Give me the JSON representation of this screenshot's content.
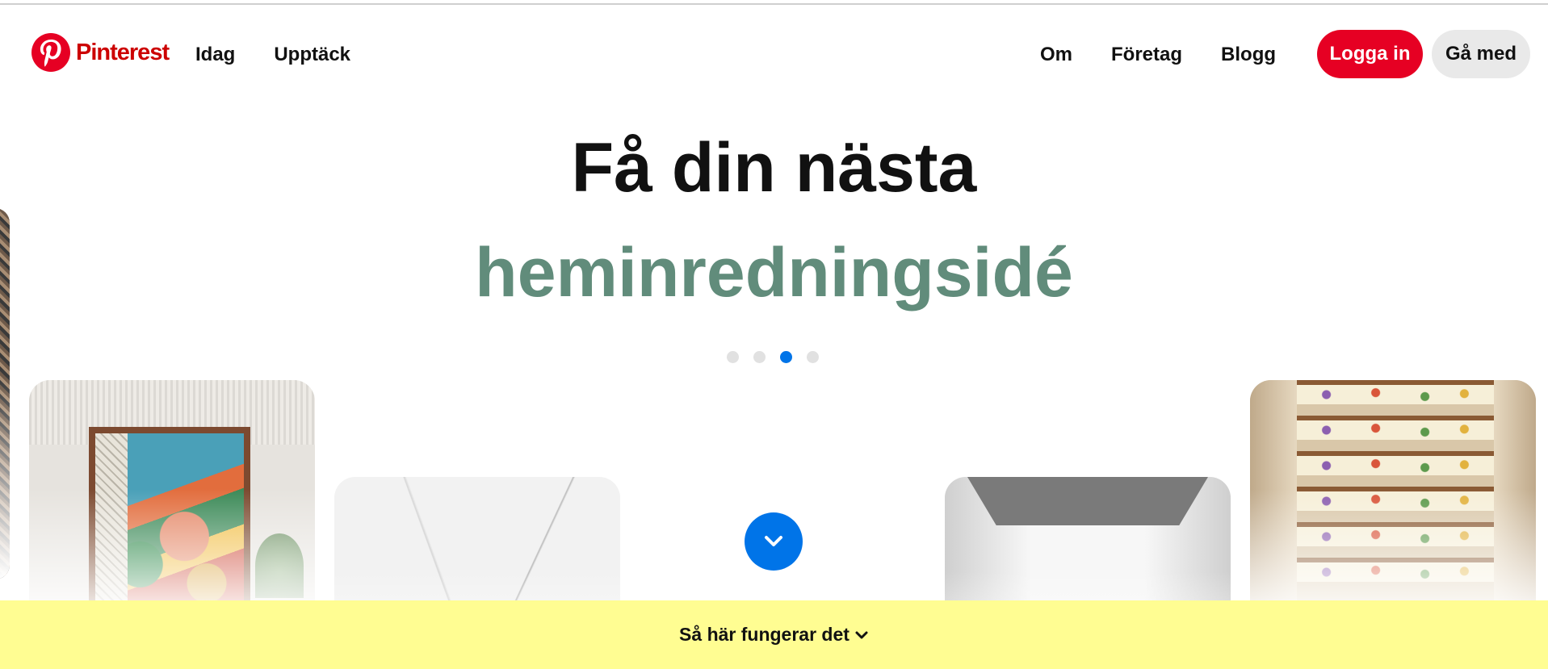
{
  "brand": {
    "name": "Pinterest",
    "color": "#cc0000",
    "logo_icon": "pinterest-logo-icon"
  },
  "nav": {
    "left": [
      {
        "label": "Idag"
      },
      {
        "label": "Upptäck"
      }
    ],
    "right": [
      {
        "label": "Om"
      },
      {
        "label": "Företag"
      },
      {
        "label": "Blogg"
      }
    ],
    "login_label": "Logga in",
    "signup_label": "Gå med"
  },
  "hero": {
    "title": "Få din nästa",
    "subtitle": "heminredningsidé",
    "subtitle_color": "#618c7b",
    "carousel_dots": 4,
    "active_dot": 3
  },
  "cards": [
    {
      "subject": "leopard print fabric",
      "position": "left edge"
    },
    {
      "subject": "mural in wooden frame"
    },
    {
      "subject": "white marble surface"
    },
    {
      "subject": "gray box interior"
    },
    {
      "subject": "floral painted staircase"
    }
  ],
  "scroll_button": {
    "icon": "chevron-down-icon",
    "color": "#0074e8"
  },
  "footer": {
    "label": "Så här fungerar det",
    "icon": "chevron-down-icon",
    "background": "#fffd92"
  },
  "colors": {
    "primary_red": "#e60023",
    "signup_gray": "#e9e9e9",
    "accent_blue": "#0074e8"
  }
}
